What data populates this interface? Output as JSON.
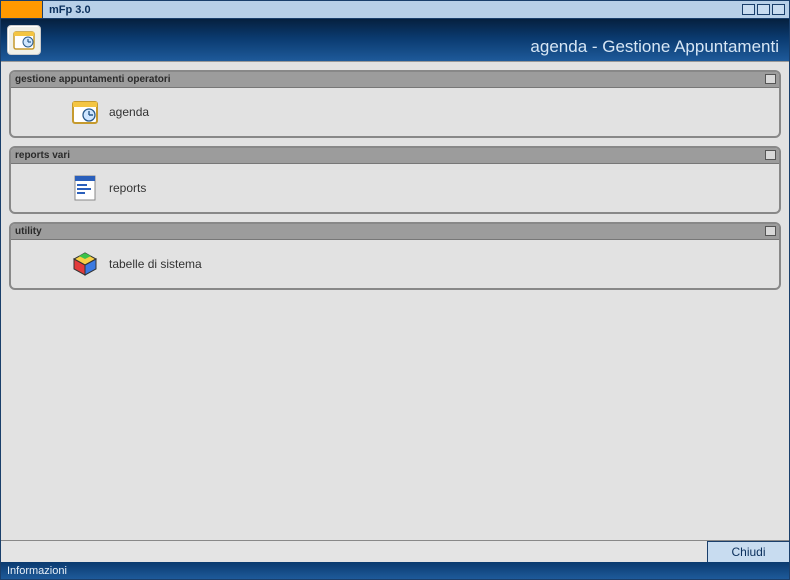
{
  "titlebar": {
    "title": "mFp 3.0"
  },
  "banner": {
    "subtitle": "agenda - Gestione Appuntamenti"
  },
  "groups": [
    {
      "title": "gestione appuntamenti operatori",
      "item": {
        "label": "agenda",
        "icon": "calendar-clock"
      }
    },
    {
      "title": "reports vari",
      "item": {
        "label": "reports",
        "icon": "report-doc"
      }
    },
    {
      "title": "utility",
      "item": {
        "label": "tabelle di sistema",
        "icon": "system-cube"
      }
    }
  ],
  "footer": {
    "close_label": "Chiudi",
    "status": "Informazioni"
  }
}
